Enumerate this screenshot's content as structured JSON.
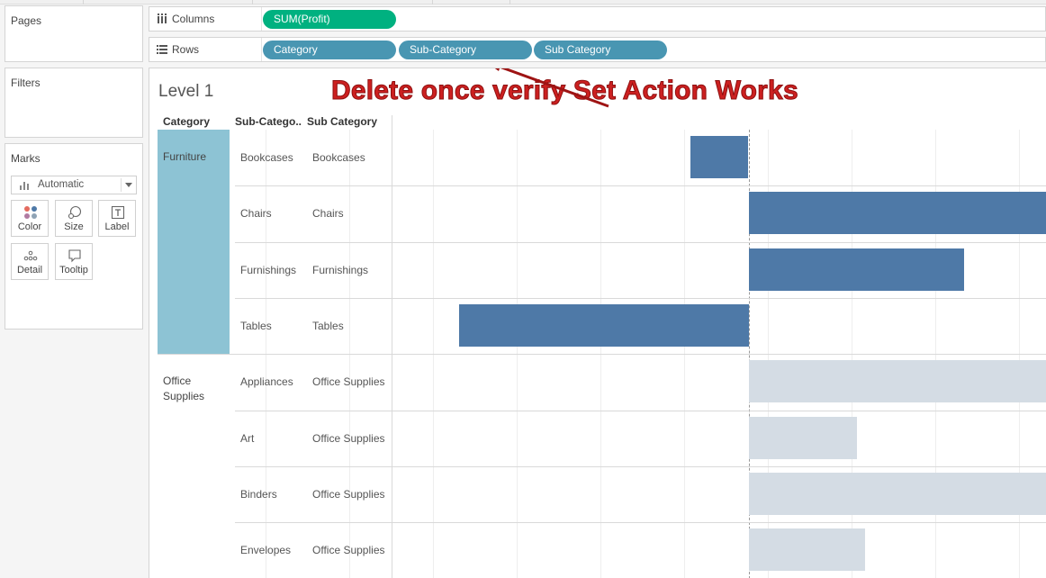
{
  "cards": {
    "pages": "Pages",
    "filters": "Filters",
    "marks": "Marks",
    "mark_type": "Automatic",
    "buttons": [
      "Color",
      "Size",
      "Label",
      "Detail",
      "Tooltip"
    ]
  },
  "shelves": {
    "columns_label": "Columns",
    "rows_label": "Rows",
    "columns_pills": [
      "SUM(Profit)"
    ],
    "rows_pills": [
      "Category",
      "Sub-Category",
      "Sub Category"
    ]
  },
  "sheet": {
    "title": "Level 1",
    "annotation": "Delete once verify Set Action Works",
    "headers": [
      "Category",
      "Sub-Catego..",
      "Sub Category"
    ]
  },
  "colors": {
    "in_set": "#4e79a7",
    "out_of_set": "#d4dce4",
    "category_highlight": "#8dc3d4",
    "columns_pill": "#00b180",
    "rows_pill": "#4996b2",
    "annotation": "#cc2020"
  },
  "chart_data": {
    "type": "bar",
    "orientation": "horizontal",
    "measure": "SUM(Profit)",
    "x_visible_range": [
      -4.3,
      3.6
    ],
    "grid": true,
    "rows": [
      {
        "category": "Furniture",
        "sub_category": "Bookcases",
        "sub_category_set": "Bookcases",
        "value": -0.7,
        "highlight": true
      },
      {
        "category": "Furniture",
        "sub_category": "Chairs",
        "sub_category_set": "Chairs",
        "value": 3.6,
        "highlight": true
      },
      {
        "category": "Furniture",
        "sub_category": "Furnishings",
        "sub_category_set": "Furnishings",
        "value": 2.6,
        "highlight": true
      },
      {
        "category": "Furniture",
        "sub_category": "Tables",
        "sub_category_set": "Tables",
        "value": -3.5,
        "highlight": true
      },
      {
        "category": "Office Supplies",
        "sub_category": "Appliances",
        "sub_category_set": "Office Supplies",
        "value": 3.6,
        "highlight": false
      },
      {
        "category": "Office Supplies",
        "sub_category": "Art",
        "sub_category_set": "Office Supplies",
        "value": 1.3,
        "highlight": false
      },
      {
        "category": "Office Supplies",
        "sub_category": "Binders",
        "sub_category_set": "Office Supplies",
        "value": 3.6,
        "highlight": false
      },
      {
        "category": "Office Supplies",
        "sub_category": "Envelopes",
        "sub_category_set": "Office Supplies",
        "value": 1.4,
        "highlight": false
      }
    ]
  }
}
